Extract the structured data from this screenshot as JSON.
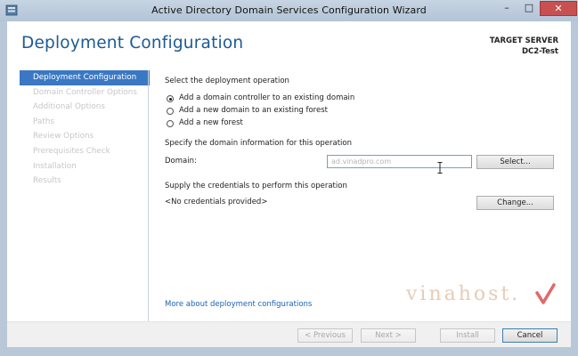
{
  "window": {
    "title": "Active Directory Domain Services Configuration Wizard",
    "controls": {
      "minimize": "–",
      "maximize": "□",
      "close": "✕"
    }
  },
  "header": {
    "page_title": "Deployment Configuration",
    "target_server_label": "TARGET SERVER",
    "target_server_name": "DC2-Test"
  },
  "sidebar": {
    "items": [
      {
        "label": "Deployment Configuration",
        "active": true
      },
      {
        "label": "Domain Controller Options",
        "active": false
      },
      {
        "label": "Additional Options",
        "active": false
      },
      {
        "label": "Paths",
        "active": false
      },
      {
        "label": "Review Options",
        "active": false
      },
      {
        "label": "Prerequisites Check",
        "active": false
      },
      {
        "label": "Installation",
        "active": false
      },
      {
        "label": "Results",
        "active": false
      }
    ]
  },
  "main": {
    "operation_heading": "Select the deployment operation",
    "options": [
      {
        "label": "Add a domain controller to an existing domain",
        "checked": true
      },
      {
        "label": "Add a new domain to an existing forest",
        "checked": false
      },
      {
        "label": "Add a new forest",
        "checked": false
      }
    ],
    "domain_heading": "Specify the domain information for this operation",
    "domain_label": "Domain:",
    "domain_value": "ad.vinadpro.com",
    "select_button": "Select...",
    "credentials_heading": "Supply the credentials to perform this operation",
    "credentials_value": "<No credentials provided>",
    "change_button": "Change...",
    "more_link": "More about deployment configurations"
  },
  "footer": {
    "previous_button": "< Previous",
    "next_button": "Next >",
    "install_button": "Install",
    "cancel_button": "Cancel"
  },
  "watermark": {
    "text": "vinahost."
  },
  "colors": {
    "accent": "#1a5a96",
    "nav_active": "#3a78c3",
    "window_frame": "#b9c8d8",
    "close_button": "#c75050"
  }
}
